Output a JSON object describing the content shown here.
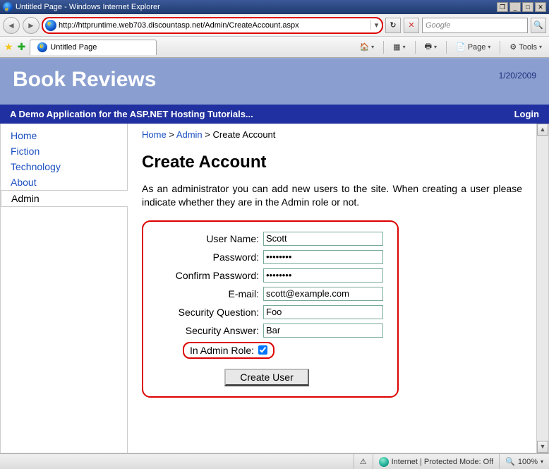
{
  "window": {
    "title": "Untitled Page - Windows Internet Explorer"
  },
  "address": {
    "url": "http://httpruntime.web703.discountasp.net/Admin/CreateAccount.aspx"
  },
  "search": {
    "placeholder": "Google"
  },
  "tab": {
    "title": "Untitled Page"
  },
  "toolbar": {
    "page": "Page",
    "tools": "Tools"
  },
  "site": {
    "title": "Book Reviews",
    "date": "1/20/2009",
    "tagline": "A Demo Application for the ASP.NET Hosting Tutorials...",
    "login": "Login"
  },
  "sidebar": {
    "items": [
      "Home",
      "Fiction",
      "Technology",
      "About",
      "Admin"
    ]
  },
  "breadcrumb": {
    "home": "Home",
    "sep": ">",
    "admin": "Admin",
    "current": "Create Account"
  },
  "page": {
    "heading": "Create Account",
    "intro": "As an administrator you can add new users to the site. When creating a user please indicate whether they are in the Admin role or not."
  },
  "form": {
    "labels": {
      "username": "User Name:",
      "password": "Password:",
      "confirm": "Confirm Password:",
      "email": "E-mail:",
      "question": "Security Question:",
      "answer": "Security Answer:",
      "adminrole": "In Admin Role:"
    },
    "values": {
      "username": "Scott",
      "password": "••••••••",
      "confirm": "••••••••",
      "email": "scott@example.com",
      "question": "Foo",
      "answer": "Bar",
      "adminrole_checked": true
    },
    "button": "Create User"
  },
  "status": {
    "zone": "Internet | Protected Mode: Off",
    "zoom": "100%"
  }
}
